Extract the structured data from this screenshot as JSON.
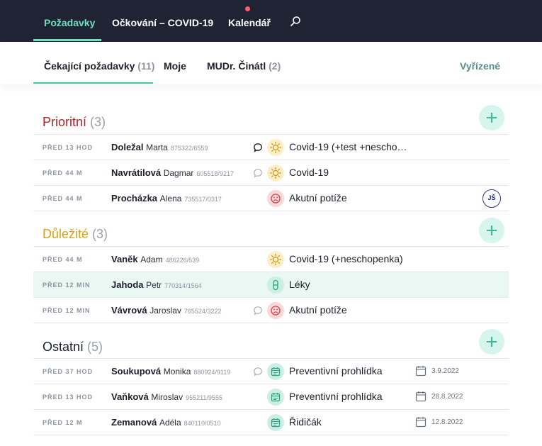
{
  "topnav": {
    "items": [
      {
        "label": "Požadavky"
      },
      {
        "label": "Očkování – COVID-19"
      },
      {
        "label": "Kalendář"
      }
    ]
  },
  "subtabs": {
    "items": [
      {
        "label": "Čekající požadavky",
        "count": "(11)"
      },
      {
        "label": "Moje",
        "count": ""
      },
      {
        "label": "MUDr. Činátl",
        "count": "(2)"
      }
    ],
    "right": "Vyřízené"
  },
  "sections": [
    {
      "title": "Prioritní",
      "count": "(3)",
      "color": "#b3232e",
      "rows": [
        {
          "time": "PŘED 13 HOD",
          "last": "Doležal",
          "first": "Marta",
          "pid": "875322/6559",
          "msg": "filled",
          "type_icon": "sun-icon",
          "type": "Covid-19 (+test +nescho…",
          "date": "",
          "assignee": ""
        },
        {
          "time": "PŘED 44 M",
          "last": "Navrátilová",
          "first": "Dagmar",
          "pid": "605518/9217",
          "msg": "light",
          "type_icon": "sun-icon",
          "type": "Covid-19",
          "date": "",
          "assignee": ""
        },
        {
          "time": "PŘED 44 M",
          "last": "Procházka",
          "first": "Alena",
          "pid": "735517/0317",
          "msg": "",
          "type_icon": "sad-face-icon",
          "type": "Akutní potíže",
          "date": "",
          "assignee": "JŠ"
        }
      ]
    },
    {
      "title": "Důležité",
      "count": "(3)",
      "color": "#d9a21b",
      "rows": [
        {
          "time": "PŘED 44 M",
          "last": "Vaněk",
          "first": "Adam",
          "pid": "486226/639",
          "msg": "",
          "type_icon": "sun-icon",
          "type": "Covid-19 (+neschopenka)",
          "date": "",
          "assignee": ""
        },
        {
          "time": "PŘED 12 MIN",
          "last": "Jahoda",
          "first": "Petr",
          "pid": "770314/1564",
          "msg": "",
          "type_icon": "pill-icon",
          "type": "Léky",
          "date": "",
          "assignee": ""
        },
        {
          "time": "PŘED 12 MIN",
          "last": "Vávrová",
          "first": "Jaroslav",
          "pid": "765524/3222",
          "msg": "light",
          "type_icon": "sad-face-icon",
          "type": "Akutní potíže",
          "date": "",
          "assignee": ""
        }
      ]
    },
    {
      "title": "Ostatní",
      "count": "(5)",
      "color": "#1d1f2b",
      "rows": [
        {
          "time": "PŘED 37 HOD",
          "last": "Soukupová",
          "first": "Monika",
          "pid": "880924/9119",
          "msg": "light",
          "type_icon": "calendar-check-icon",
          "type": "Preventivní prohlídka",
          "date": "3.9.2022",
          "assignee": ""
        },
        {
          "time": "PŘED 13 HOD",
          "last": "Vaňková",
          "first": "Miroslav",
          "pid": "955211/9555",
          "msg": "",
          "type_icon": "calendar-check-icon",
          "type": "Preventivní prohlídka",
          "date": "28.8.2022",
          "assignee": ""
        },
        {
          "time": "PŘED 12 M",
          "last": "Zemanová",
          "first": "Adéla",
          "pid": "840110/0510",
          "msg": "",
          "type_icon": "calendar-check-icon",
          "type": "Řidičák",
          "date": "12.8.2022",
          "assignee": ""
        }
      ]
    }
  ],
  "colors": {
    "accent": "#6ee0c2",
    "nav_bg": "#1f2334",
    "highlight_row": "#e9f8f3"
  }
}
